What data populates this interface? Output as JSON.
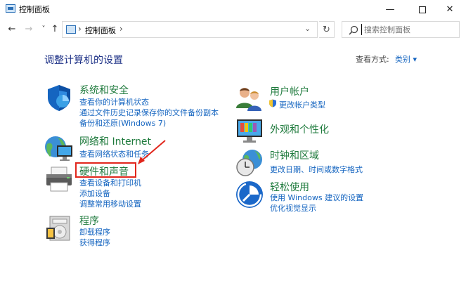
{
  "window": {
    "title": "控制面板",
    "minimize": "—",
    "close": "✕"
  },
  "nav": {
    "back": "←",
    "forward": "→",
    "recent": "˅",
    "up": "↑",
    "refresh": "↻",
    "breadcrumb": "控制面板",
    "separator": "›",
    "dropdown": "⌄"
  },
  "search": {
    "placeholder": "搜索控制面板"
  },
  "header": {
    "title": "调整计算机的设置",
    "view_label": "查看方式:",
    "view_value": "类别 ▾"
  },
  "left_categories": [
    {
      "title": "系统和安全",
      "links": [
        "查看你的计算机状态",
        "通过文件历史记录保存你的文件备份副本",
        "备份和还原(Windows 7)"
      ]
    },
    {
      "title": "网络和 Internet",
      "links": [
        "查看网络状态和任务"
      ]
    },
    {
      "title": "硬件和声音",
      "links": [
        "查看设备和打印机",
        "添加设备",
        "调整常用移动设置"
      ]
    },
    {
      "title": "程序",
      "links": [
        "卸载程序",
        "获得程序"
      ]
    }
  ],
  "right_categories": [
    {
      "title": "用户帐户",
      "links": [
        "更改帐户类型"
      ]
    },
    {
      "title": "外观和个性化",
      "links": []
    },
    {
      "title": "时钟和区域",
      "links": [
        "更改日期、时间或数字格式"
      ]
    },
    {
      "title": "轻松使用",
      "links": [
        "使用 Windows 建议的设置",
        "优化视觉显示"
      ]
    }
  ],
  "colors": {
    "title_blue": "#1e3287",
    "category_green": "#1e7a3c",
    "link_blue": "#1565c0",
    "annotation_red": "#e1261c"
  }
}
